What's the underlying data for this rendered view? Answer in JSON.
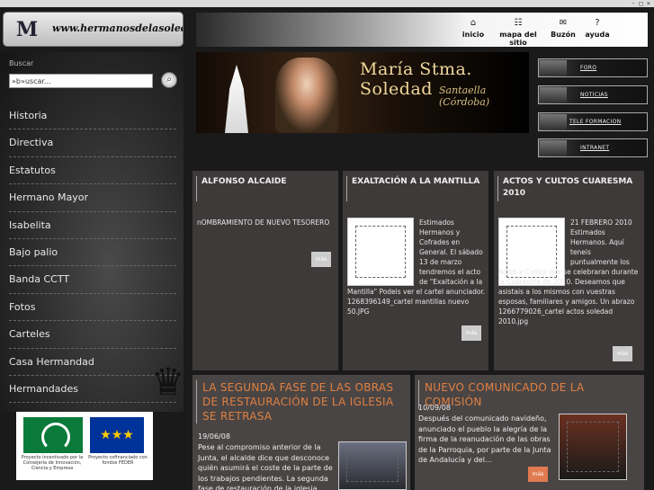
{
  "window_controls": "- □ ×",
  "logo": {
    "monogram": "M",
    "url": "www.hermanosdelasoledad.com"
  },
  "topnav": [
    {
      "label": "inicio",
      "icon": "⌂"
    },
    {
      "label": "mapa del sitio",
      "icon": "☷"
    },
    {
      "label": "Buzón",
      "icon": "✉"
    },
    {
      "label": "ayuda",
      "icon": "?"
    }
  ],
  "search": {
    "label": "Buscar",
    "value": "»b»uscar...",
    "button_icon": "⌕"
  },
  "menu": [
    "Historia",
    "Directiva",
    "Estatutos",
    "Hermano Mayor",
    "Isabelita",
    "Bajo palio",
    "Banda CCTT",
    "Fotos",
    "Carteles",
    "Casa Hermandad",
    "Hermandades"
  ],
  "sponsor": {
    "junta_text": "Proyecto incentivado por la Consejería de Innovación, Ciencia y Empresa",
    "eu_text": "Proyecto cofinanciado con fondos FEDER",
    "eu_stars": "★★★"
  },
  "crest_glyph": "♛",
  "banner": {
    "title": "María Stma. Soledad",
    "subtitle": "Santaella (Córdoba)"
  },
  "side_buttons": [
    "FORO",
    "NOTICIAS",
    "TELE FORMACION",
    "INTRANET"
  ],
  "news": [
    {
      "title": "ALFONSO ALCAIDE",
      "text": "nOMBRAMIENTO DE NUEVO TESORERO",
      "more": "más"
    },
    {
      "title": "EXALTACIÓN A LA MANTILLA",
      "text": "Estimados Hermanos y Cofrades en General. El sábado 13 de marzo tendremos el acto de \"Exaltación a la Mantilla\" Podeis ver el cartel anunciador. 1268396149_cartel mantillas nuevo 50.JPG",
      "more": "más"
    },
    {
      "title": "ACTOS Y CULTOS CUARESMA 2010",
      "text": "21 FEBRERO 2010 Estimados Hermanos. Aquí teneis puntualmente los Actos y Cultos que se celebraran durante la Cuaresma de 2010. Deseamos que asistais a los mismos con vuestras esposas, familiares y amigos. Un abrazo 1266779026_cartel actos soledad 2010.jpg",
      "more": "más"
    }
  ],
  "news_big": [
    {
      "title": "LA SEGUNDA FASE DE LAS OBRAS DE RESTAURACIÓN DE LA IGLESIA SE RETRASA",
      "date": "19/06/08",
      "text": "Pese al compromiso anterior de la Junta, el alcalde dice que desconoce quién asumirá el coste de la parte de los trabajos pendientes. La segunda fase de restauración de la iglesia de..."
    },
    {
      "title": "NUEVO COMUNICADO DE LA COMISIÓN",
      "date": "10/09/08",
      "text": "Después del comunicado navideño, anunciado el pueblo la alegría de la firma de la reanudación de las obras de la Parroquia, por parte de la Junta de Andalucía y del...",
      "more": "más"
    }
  ]
}
